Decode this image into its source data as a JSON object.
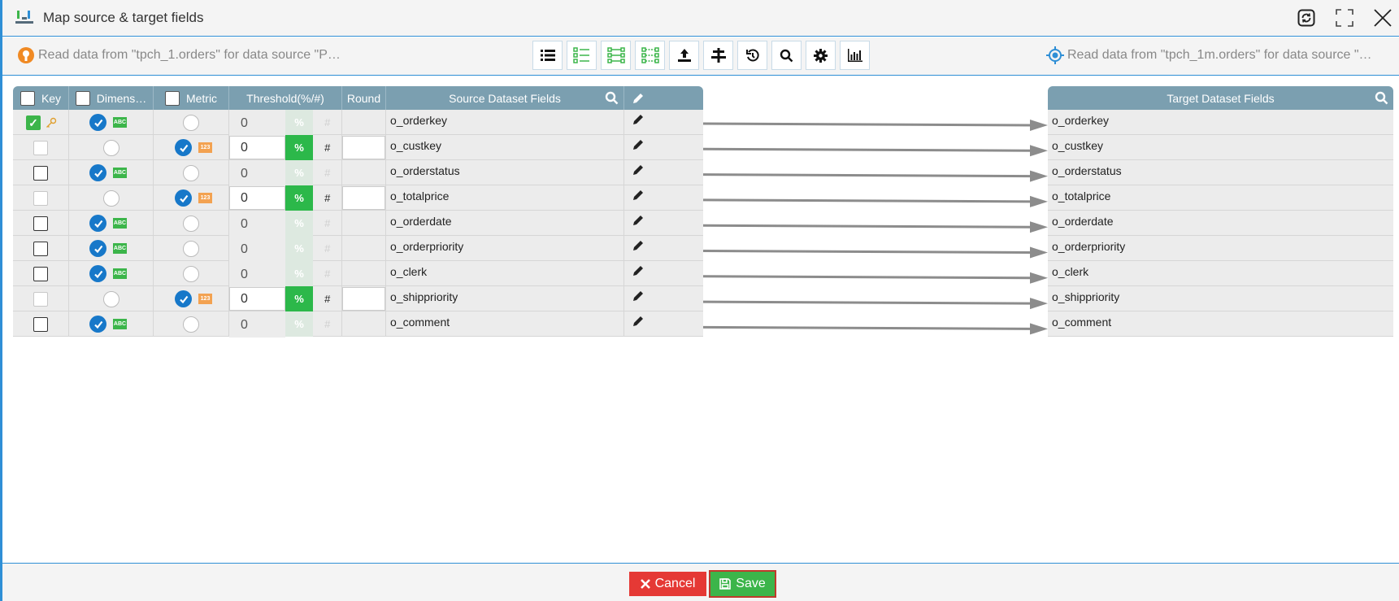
{
  "window": {
    "title": "Map source & target fields"
  },
  "toolbar": {
    "source_label": "Read data from \"tpch_1.orders\" for data source \"P…",
    "target_label": "Read data from \"tpch_1m.orders\" for data source \"…",
    "tools": [
      "list-icon",
      "list-check-icon",
      "list-link-icon",
      "list-auto-map-icon",
      "upload-icon",
      "align-icon",
      "reset-icon",
      "search-icon",
      "gear-icon",
      "bar-chart-icon"
    ]
  },
  "source_grid": {
    "headers": {
      "key": "Key",
      "dimension": "Dimens…",
      "metric": "Metric",
      "threshold": "Threshold(%/#)",
      "round": "Round",
      "fields": "Source Dataset Fields"
    },
    "rows": [
      {
        "field": "o_orderkey",
        "key": true,
        "dimension": true,
        "metric": false,
        "type": "ABC",
        "threshold": "0",
        "pct": "%",
        "hash": "#"
      },
      {
        "field": "o_custkey",
        "key": false,
        "dimension": false,
        "metric": true,
        "type": "123",
        "threshold": "0",
        "pct": "%",
        "hash": "#"
      },
      {
        "field": "o_orderstatus",
        "key": false,
        "dimension": true,
        "metric": false,
        "type": "ABC",
        "threshold": "0",
        "pct": "%",
        "hash": "#"
      },
      {
        "field": "o_totalprice",
        "key": false,
        "dimension": false,
        "metric": true,
        "type": "123",
        "threshold": "0",
        "pct": "%",
        "hash": "#"
      },
      {
        "field": "o_orderdate",
        "key": false,
        "dimension": true,
        "metric": false,
        "type": "ABC",
        "threshold": "0",
        "pct": "%",
        "hash": "#"
      },
      {
        "field": "o_orderpriority",
        "key": false,
        "dimension": true,
        "metric": false,
        "type": "ABC",
        "threshold": "0",
        "pct": "%",
        "hash": "#"
      },
      {
        "field": "o_clerk",
        "key": false,
        "dimension": true,
        "metric": false,
        "type": "ABC",
        "threshold": "0",
        "pct": "%",
        "hash": "#"
      },
      {
        "field": "o_shippriority",
        "key": false,
        "dimension": false,
        "metric": true,
        "type": "123",
        "threshold": "0",
        "pct": "%",
        "hash": "#"
      },
      {
        "field": "o_comment",
        "key": false,
        "dimension": true,
        "metric": false,
        "type": "ABC",
        "threshold": "0",
        "pct": "%",
        "hash": "#"
      }
    ]
  },
  "target_grid": {
    "header": "Target Dataset Fields",
    "rows": [
      "o_orderkey",
      "o_custkey",
      "o_orderstatus",
      "o_totalprice",
      "o_orderdate",
      "o_orderpriority",
      "o_clerk",
      "o_shippriority",
      "o_comment"
    ]
  },
  "footer": {
    "cancel_label": "Cancel",
    "save_label": "Save"
  },
  "colors": {
    "accent": "#2f8fd6",
    "header": "#7b9fb0",
    "green": "#2cb84a",
    "red": "#e53935",
    "blue": "#1778c9",
    "orange": "#f3a251"
  }
}
